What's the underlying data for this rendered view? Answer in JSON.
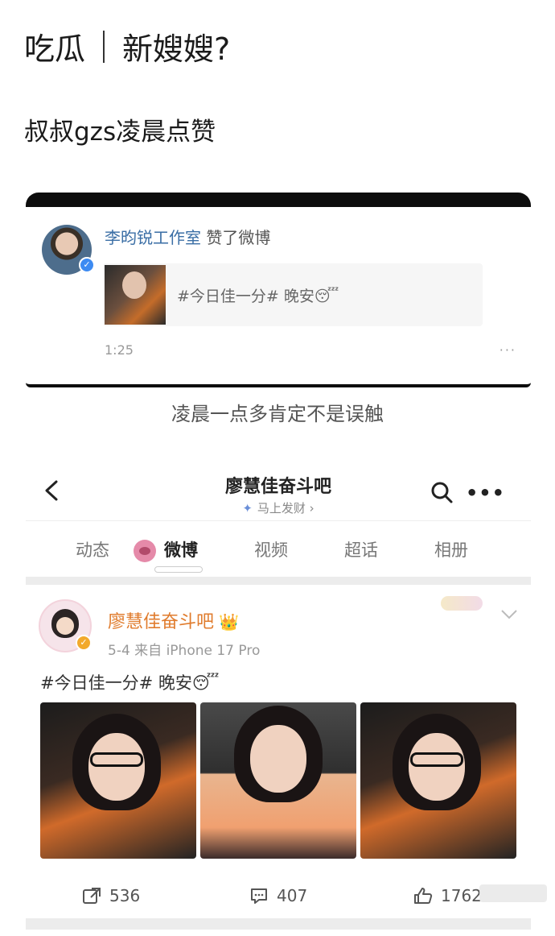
{
  "header": {
    "title_left": "吃瓜",
    "title_right": "新嫂嫂?"
  },
  "subline": "叔叔gzs凌晨点赞",
  "like_card": {
    "account": "李昀锐工作室",
    "action": "赞了微博",
    "quote_text": "#今日佳一分# 晚安😴",
    "time": "1:25",
    "more": "···"
  },
  "caption": "凌晨一点多肯定不是误触",
  "profile_nav": {
    "title": "廖慧佳奋斗吧",
    "subtitle": "马上发财 ›"
  },
  "tabs": [
    {
      "label": "动态",
      "active": false
    },
    {
      "label": "微博",
      "active": true
    },
    {
      "label": "视频",
      "active": false
    },
    {
      "label": "超话",
      "active": false
    },
    {
      "label": "相册",
      "active": false
    }
  ],
  "post": {
    "author": "廖慧佳奋斗吧",
    "crown": "👑",
    "meta": "5-4  来自 iPhone 17 Pro",
    "text": "#今日佳一分# 晚安😴",
    "repost_count": "536",
    "comment_count": "407",
    "like_count": "1762"
  },
  "colors": {
    "accent_name": "#e07b2c",
    "verified_blue": "#3d8bf2",
    "link": "#3a6ea5"
  }
}
